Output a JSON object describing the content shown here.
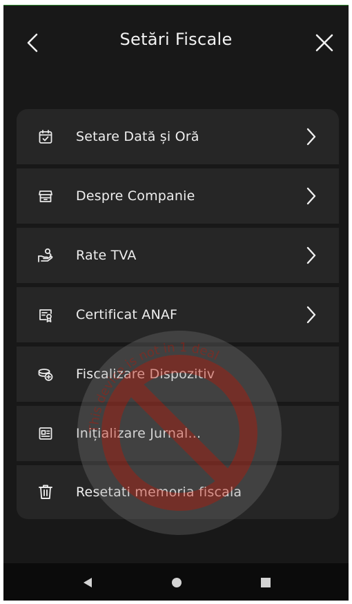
{
  "header": {
    "title": "Setări Fiscale",
    "back_icon": "chevron-left-icon",
    "close_icon": "close-icon"
  },
  "menu": {
    "items": [
      {
        "label": "Setare Dată și Oră",
        "icon": "calendar-check-icon",
        "has_chevron": true
      },
      {
        "label": "Despre Companie",
        "icon": "store-icon",
        "has_chevron": true
      },
      {
        "label": "Rate TVA",
        "icon": "hand-coins-icon",
        "has_chevron": true
      },
      {
        "label": "Certificat ANAF",
        "icon": "certificate-icon",
        "has_chevron": true
      },
      {
        "label": "Fiscalizare Dispozitiv",
        "icon": "coins-stack-icon",
        "has_chevron": false
      },
      {
        "label": "Inițializare Jurnal...",
        "icon": "receipt-id-icon",
        "has_chevron": false
      },
      {
        "label": "Resetati memoria fiscala",
        "icon": "trash-icon",
        "has_chevron": false
      }
    ]
  },
  "watermark": {
    "text": "This device is not in 1 deal"
  },
  "navbar": {
    "back_icon": "nav-back-icon",
    "home_icon": "nav-home-icon",
    "recent_icon": "nav-recent-icon"
  },
  "colors": {
    "background": "#181818",
    "card": "#262626",
    "text": "#efefef",
    "watermark": "#c0392b"
  }
}
